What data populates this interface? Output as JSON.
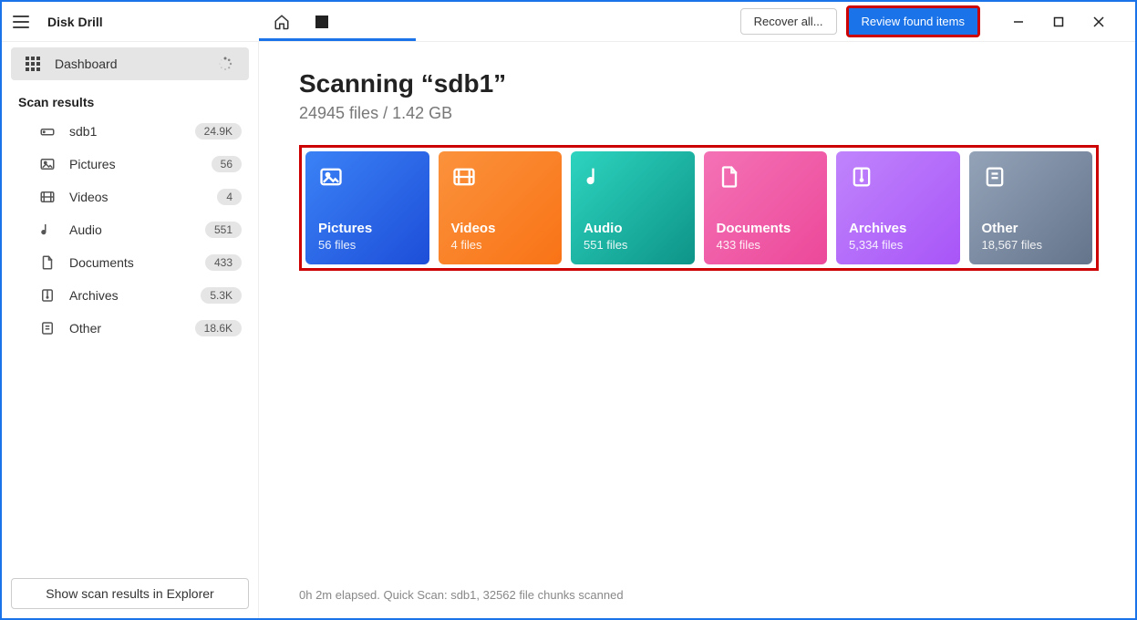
{
  "app_title": "Disk Drill",
  "toolbar": {
    "recover_all": "Recover all...",
    "review_found": "Review found items"
  },
  "sidebar": {
    "dashboard_label": "Dashboard",
    "scan_results_heading": "Scan results",
    "items": [
      {
        "label": "sdb1",
        "badge": "24.9K"
      },
      {
        "label": "Pictures",
        "badge": "56"
      },
      {
        "label": "Videos",
        "badge": "4"
      },
      {
        "label": "Audio",
        "badge": "551"
      },
      {
        "label": "Documents",
        "badge": "433"
      },
      {
        "label": "Archives",
        "badge": "5.3K"
      },
      {
        "label": "Other",
        "badge": "18.6K"
      }
    ],
    "explorer_btn": "Show scan results in Explorer"
  },
  "main": {
    "title": "Scanning “sdb1”",
    "subtitle": "24945 files / 1.42 GB",
    "cards": [
      {
        "title": "Pictures",
        "sub": "56 files"
      },
      {
        "title": "Videos",
        "sub": "4 files"
      },
      {
        "title": "Audio",
        "sub": "551 files"
      },
      {
        "title": "Documents",
        "sub": "433 files"
      },
      {
        "title": "Archives",
        "sub": "5,334 files"
      },
      {
        "title": "Other",
        "sub": "18,567 files"
      }
    ],
    "status": "0h 2m elapsed. Quick Scan: sdb1, 32562 file chunks scanned"
  }
}
